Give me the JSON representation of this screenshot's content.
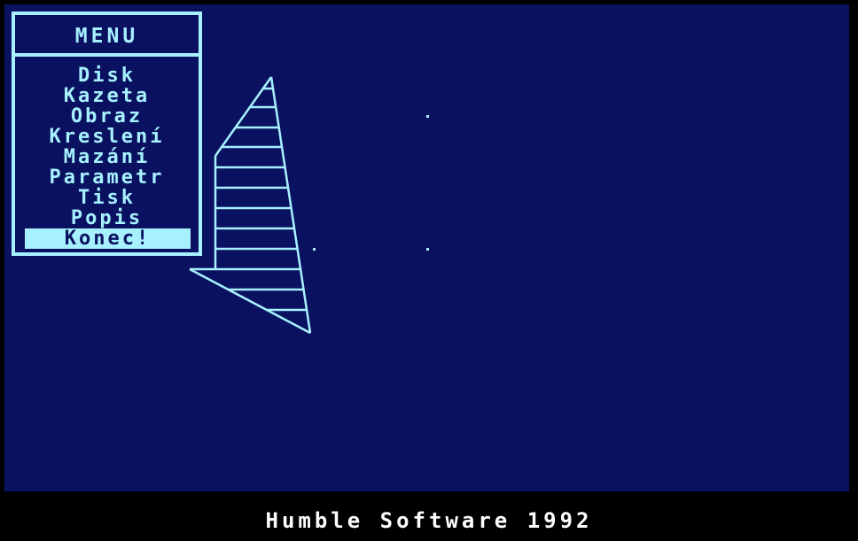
{
  "menu": {
    "title": "MENU",
    "items": [
      {
        "label": "Disk"
      },
      {
        "label": "Kazeta"
      },
      {
        "label": "Obraz"
      },
      {
        "label": "Kreslení"
      },
      {
        "label": "Mazání"
      },
      {
        "label": "Parametr"
      },
      {
        "label": "Tisk"
      },
      {
        "label": "Popis"
      },
      {
        "label": "Konec!"
      }
    ],
    "selected": "Konec!"
  },
  "footer": {
    "text": "Humble Software 1992"
  },
  "colors": {
    "background": "#0a1160",
    "foreground": "#a7f1ff",
    "border": "#000000",
    "footer_text": "#ffffff"
  }
}
